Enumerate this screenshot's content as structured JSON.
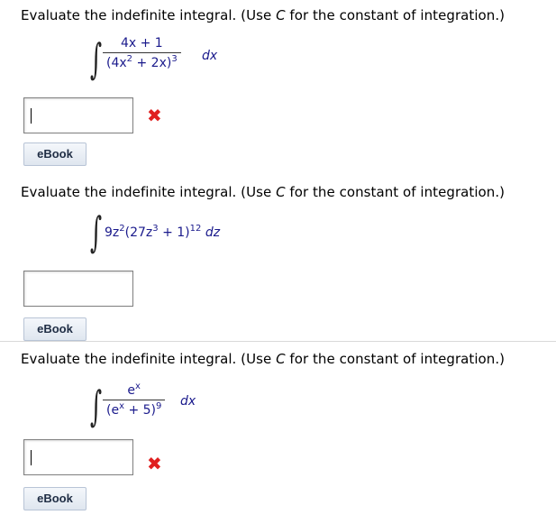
{
  "prompt": {
    "prefix": "Evaluate the indefinite integral. (Use ",
    "c": "C",
    "suffix": " for the constant of integration.)"
  },
  "questions": [
    {
      "numerator": "4x + 1",
      "denominator_base": "(4x",
      "denominator_exp1": "2",
      "denominator_mid": " + 2x)",
      "denominator_exp2": "3",
      "differential": "dx",
      "answer_value": "",
      "status": "incorrect"
    },
    {
      "integrand_part1": "9z",
      "integrand_exp1": "2",
      "integrand_part2": "(27z",
      "integrand_exp2": "3",
      "integrand_part3": " + 1)",
      "integrand_exp3": "12",
      "differential": "dz",
      "answer_value": "",
      "status": "unanswered"
    },
    {
      "numerator_base": "e",
      "numerator_exp": "x",
      "denominator_base": "(e",
      "denominator_exp1": "x",
      "denominator_mid": " + 5)",
      "denominator_exp2": "9",
      "differential": "dx",
      "answer_value": "",
      "status": "incorrect"
    }
  ],
  "ebook_label": "eBook",
  "icons": {
    "incorrect": "x-mark-icon",
    "integral": "integral-sign-icon"
  },
  "colors": {
    "incorrect": "#e02020",
    "math": "#1a1a8c"
  }
}
